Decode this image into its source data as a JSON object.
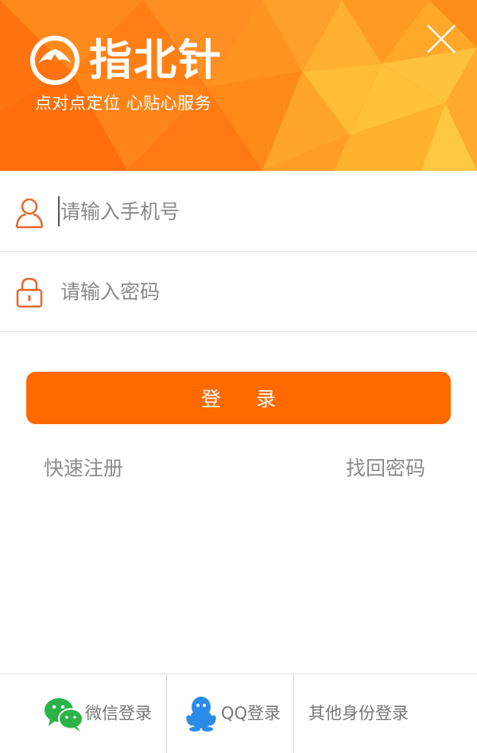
{
  "header": {
    "brand_name": "指北针",
    "slogan": "点对点定位 心贴心服务",
    "logo_icon": "compass-logo-icon",
    "close_icon": "close-icon"
  },
  "form": {
    "phone": {
      "placeholder": "请输入手机号",
      "value": "",
      "icon": "user-icon"
    },
    "password": {
      "placeholder": "请输入密码",
      "value": "",
      "icon": "lock-icon"
    },
    "login_label": "登 录"
  },
  "links": {
    "register": "快速注册",
    "forgot_password": "找回密码"
  },
  "bottom_bar": {
    "items": [
      {
        "label": "微信登录",
        "icon": "wechat-icon"
      },
      {
        "label": "QQ登录",
        "icon": "qq-penguin-icon"
      },
      {
        "label": "其他身份登录"
      }
    ]
  },
  "colors": {
    "accent": "#ff6a00",
    "banner": "#ff7a10",
    "icon": "#e8672a",
    "wechat": "#2bb34a",
    "qq": "#2b8ce8"
  }
}
